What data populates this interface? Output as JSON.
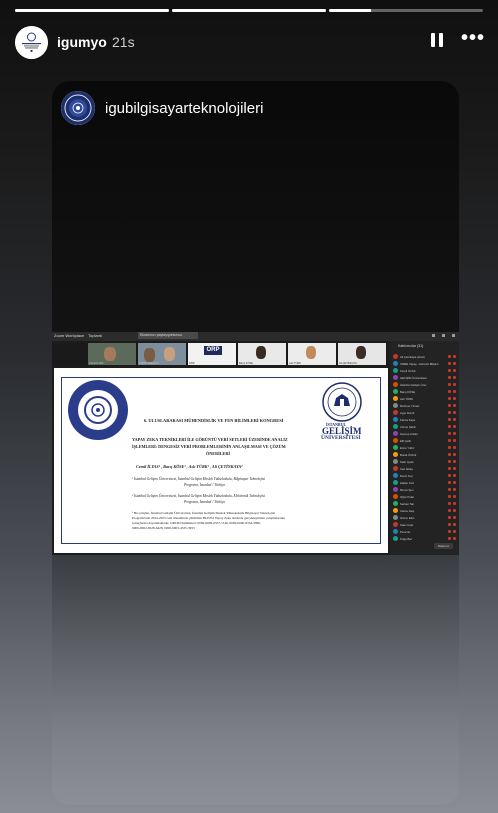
{
  "story": {
    "progress_segments": [
      1,
      1,
      0.27
    ],
    "username": "igumyo",
    "time_ago": "21s",
    "card_username": "igubilgisayarteknolojileri"
  },
  "meeting": {
    "app_title": "Zoom Workplace",
    "tab_home": "Toplantı",
    "tab_share": "Ekranınızı paylaşıyorsunuz",
    "participants_title": "Katılımcılar (31)",
    "tiles": [
      {
        "name": "Cemil İLYAS",
        "kind": "video"
      },
      {
        "name": "CMRE Toplantısı",
        "kind": "video"
      },
      {
        "name": "ORP",
        "kind": "logo"
      },
      {
        "name": "Barış KÖSE",
        "kind": "video"
      },
      {
        "name": "Aslı TÜRK",
        "kind": "video"
      },
      {
        "name": "Ali ÇETİNKAYA",
        "kind": "video"
      }
    ],
    "participants": [
      "Ali Çetinkaya (Host)",
      "CMRE Yapay...Görüntü Bilişimi",
      "Cemil İLYAS",
      "GELİŞİM Üniversitesi",
      "İstanbul Gelişim Üniv",
      "Barış KÖSE",
      "Aslı TÜRK",
      "Mehmet Yılmaz",
      "Ayşe Demir",
      "Fatma Kaya",
      "Ahmet Şahin",
      "Zeynep Arslan",
      "Elif Çelik",
      "Emre Yıldız",
      "Burak Öztürk",
      "Selin Aydın",
      "Can Aktaş",
      "Deniz Koç",
      "Hakan Kurt",
      "Merve Şen",
      "Oğuz Polat",
      "Serkan Tan",
      "Cansu Ateş",
      "Gizem Ekin",
      "Kaan Uçar",
      "Pınar Er",
      "Tolga Bal"
    ],
    "invite_label": "Davet et",
    "slide": {
      "congress_title": "6. ULUSLARARASI MÜHENDİSLİK VE FEN BİLİMLERİ KONGRESİ",
      "paper_title_1": "YAPAY ZEKA TEKNİKLERİ İLE GÖRÜNTÜ VERİ SETLERİ ÜZERİNDE ANALİZ",
      "paper_title_2": "İŞLEMLERİ: DENGESİZ VERİ PROBLEMLERİNİN ANLAŞILMASI VE ÇÖZÜM",
      "paper_title_3": "ÖNERİLERİ",
      "authors": "Cemil İLYAS¹ , Barış KÖSE¹ , Aslı TÜRK¹ , Ali ÇETİNKAYA²",
      "affil_1a": "¹ İstanbul Gelişim Üniversitesi, İstanbul Gelişim Meslek Yüksekokulu, Bilgisayar Teknolojisi",
      "affil_1b": "Programı, İstanbul / Türkiye",
      "affil_2a": "² İstanbul Gelişim Üniversitesi, İstanbul Gelişim Meslek Yüksekokulu, Elektronik Teknolojisi",
      "affil_2b": "Programı, İstanbul / Türkiye",
      "footnote_1": "¹ Bu çalışma, İstanbul Gelişim Üniversitesi, İstanbul Gelişim Meslek Yüksekokulu Bilgisayar Teknolojisi",
      "footnote_2": "Programı'nda 2024-2025 Güz döneminde yürütülen BLP252 Yapay Zeka dersinde gerçekleştirilen çalışmalarının",
      "footnote_3": "sonuçlarına dayanmaktadır. ORCID Kimlikleri: 0009-0009-0537-1146, 0009-0000-6354-3860,",
      "footnote_4": "0009-0002-6528-6428, 0000-0003-4535-3953",
      "gelisim_small": "İSTANBUL",
      "gelisim_big": "GELİŞİM",
      "gelisim_uni": "ÜNİVERSİTESİ"
    }
  }
}
